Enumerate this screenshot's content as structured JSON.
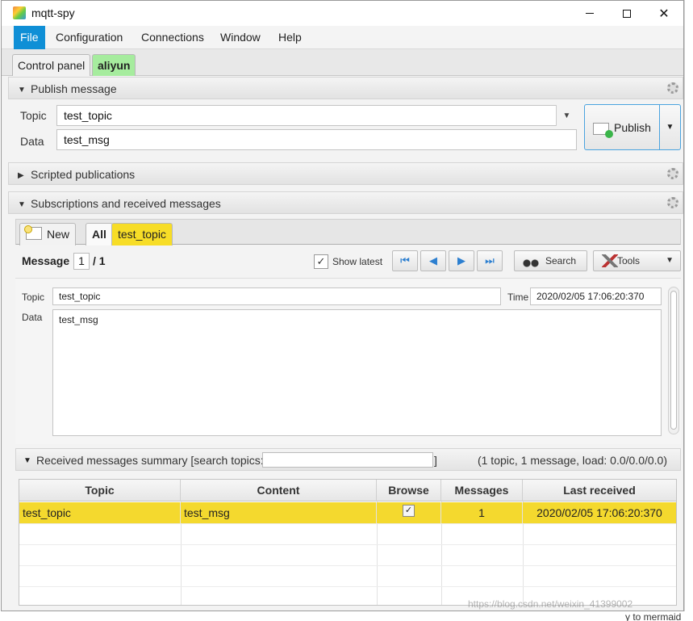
{
  "window": {
    "title": "mqtt-spy"
  },
  "menu": [
    "File",
    "Configuration",
    "Connections",
    "Window",
    "Help"
  ],
  "tabs": [
    {
      "label": "Control panel",
      "selected": false
    },
    {
      "label": "aliyun",
      "selected": true
    }
  ],
  "publish": {
    "section_title": "Publish message",
    "topic_label": "Topic",
    "topic_value": "test_topic",
    "data_label": "Data",
    "data_value": "test_msg",
    "button_label": "Publish"
  },
  "scripted": {
    "section_title": "Scripted publications"
  },
  "subscriptions": {
    "section_title": "Subscriptions and received messages",
    "tabs": [
      {
        "label": "New"
      },
      {
        "label": "All"
      },
      {
        "label": "test_topic"
      }
    ],
    "message_label": "Message",
    "message_index": "1",
    "message_total": "/ 1",
    "show_latest_label": "Show latest",
    "show_latest_checked": true,
    "search_label": "Search",
    "tools_label": "Tools",
    "detail": {
      "topic_label": "Topic",
      "topic_value": "test_topic",
      "time_label": "Time",
      "time_value": "2020/02/05 17:06:20:370",
      "data_label": "Data",
      "data_value": "test_msg"
    }
  },
  "summary": {
    "title": "Received messages summary [search topics:",
    "bracket": "]",
    "stats": "(1 topic, 1 message, load: 0.0/0.0/0.0)",
    "columns": [
      "Topic",
      "Content",
      "Browse",
      "Messages",
      "Last received"
    ],
    "rows": [
      {
        "topic": "test_topic",
        "content": "test_msg",
        "browse": true,
        "messages": "1",
        "last_received": "2020/02/05 17:06:20:370"
      }
    ]
  },
  "watermark": "https://blog.csdn.net/weixin_41399002",
  "background_text": "y to mermaid",
  "colors": {
    "accent": "#0f8fd6",
    "selected_tab": "#a6ec9e",
    "topic_highlight": "#f4d92e"
  }
}
